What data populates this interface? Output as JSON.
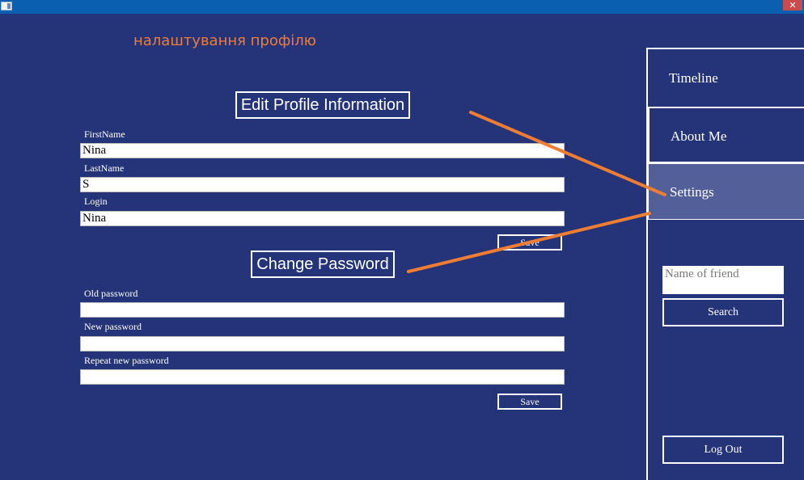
{
  "window": {
    "close_glyph": "✕",
    "icon": "app-window-icon"
  },
  "annotation": {
    "title": "налаштування профілю",
    "arrow_color": "#f07d34"
  },
  "profile": {
    "heading": "Edit Profile Information",
    "firstname_label": "FirstName",
    "firstname_value": "Nina",
    "lastname_label": "LastName",
    "lastname_value": "S",
    "login_label": "Login",
    "login_value": "Nina",
    "save_label": "Save"
  },
  "password": {
    "heading": "Change Password",
    "old_label": "Old password",
    "new_label": "New password",
    "repeat_label": "Repeat new password",
    "old_value": "",
    "new_value": "",
    "repeat_value": "",
    "save_label": "Save"
  },
  "sidebar": {
    "items": [
      {
        "label": "Timeline"
      },
      {
        "label": "About Me"
      },
      {
        "label": "Settings",
        "selected": true
      }
    ],
    "friend_search": {
      "placeholder": "Name of friend",
      "value": "",
      "button_label": "Search"
    },
    "logout_label": "Log Out"
  },
  "colors": {
    "background": "#253378",
    "titlebar": "#0b5fb0",
    "selected_nav": "#525f99",
    "accent": "#ee7d3a"
  }
}
